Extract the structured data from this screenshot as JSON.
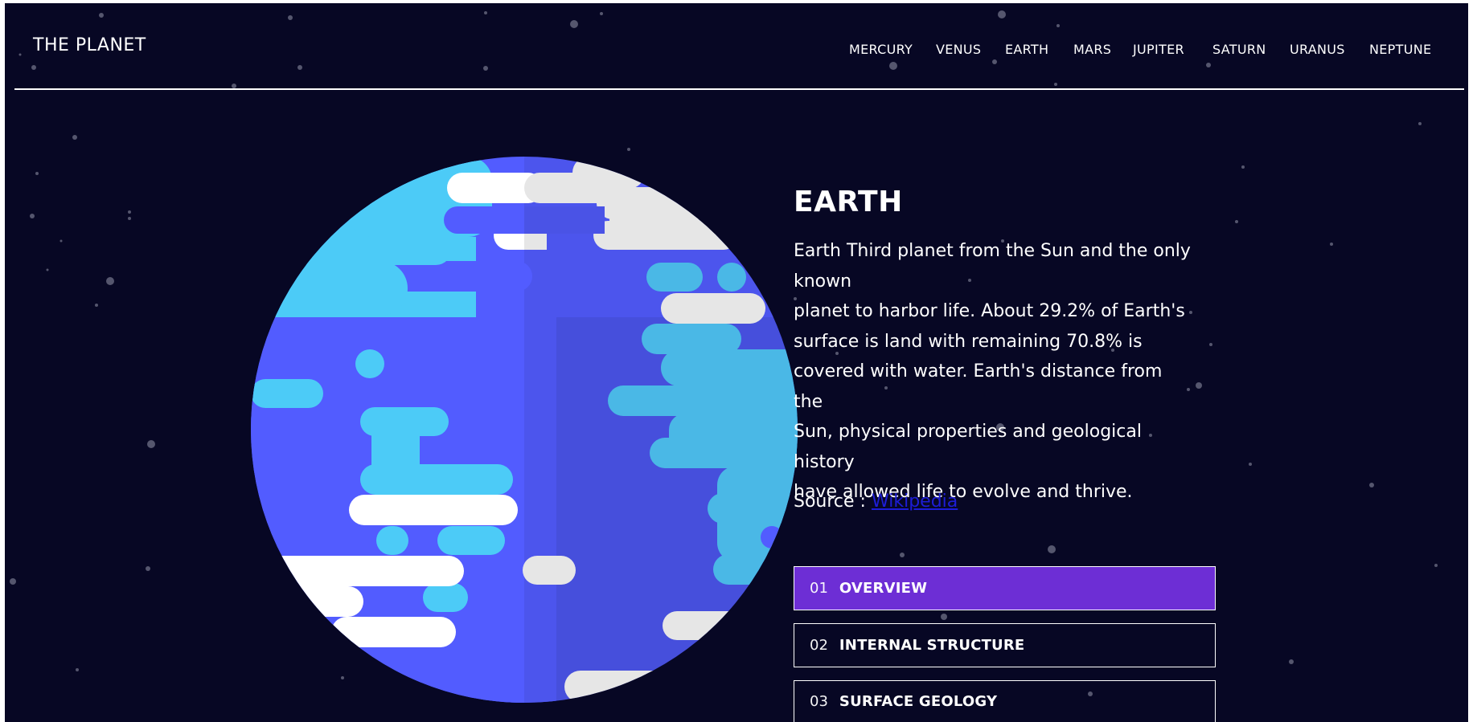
{
  "header": {
    "logo": "THE PLANET",
    "nav": [
      "MERCURY",
      "VENUS",
      "EARTH",
      "MARS",
      "JUPITER",
      "SATURN",
      "URANUS",
      "NEPTUNE"
    ]
  },
  "planet": {
    "name": "EARTH",
    "description_lines": [
      "Earth Third planet from the Sun and the only",
      "known",
      "planet to harbor life. About 29.2% of Earth's",
      "surface is land with remaining 70.8% is",
      "covered with water. Earth's distance from the",
      "Sun, physical properties and geological history",
      "have allowed life to evolve and thrive."
    ],
    "source_label": "Source :",
    "source_link": "Wikipedia"
  },
  "tabs": [
    {
      "num": "01",
      "label": "OVERVIEW",
      "active": true
    },
    {
      "num": "02",
      "label": "INTERNAL STRUCTURE",
      "active": false
    },
    {
      "num": "03",
      "label": "SURFACE GEOLOGY",
      "active": false
    }
  ],
  "colors": {
    "background": "#070724",
    "accent": "#6d2ed5",
    "ocean": "#525cff",
    "land": "#4ccbf7",
    "clouds": "#ffffff",
    "link": "#1d1dd6"
  }
}
